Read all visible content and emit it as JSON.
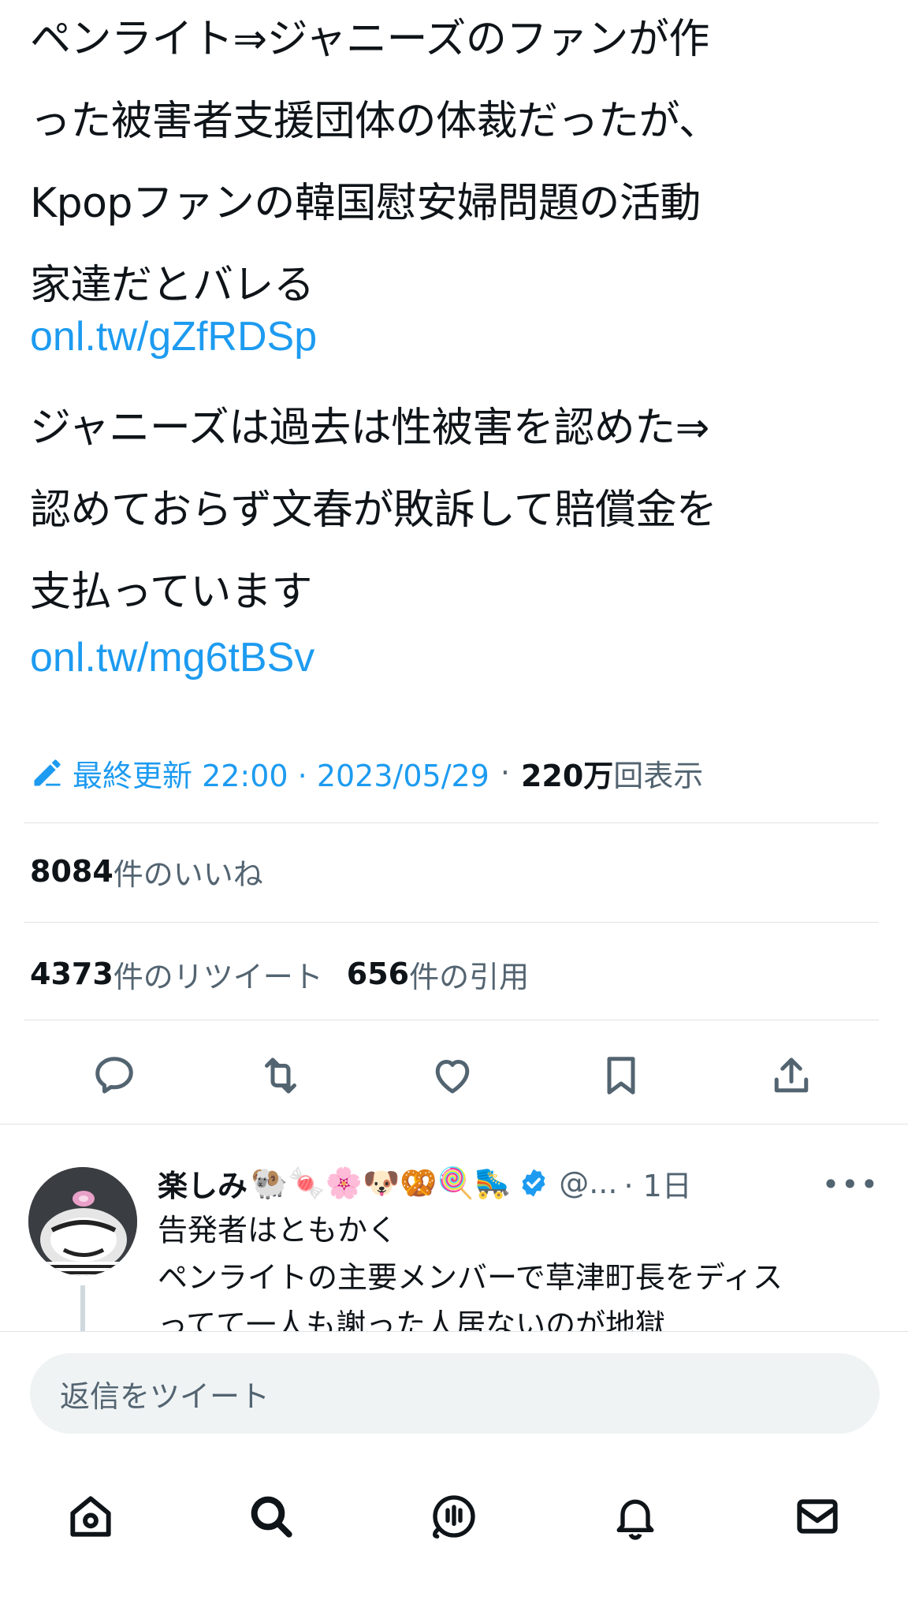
{
  "tweet": {
    "paragraph1": [
      "ペンライト⇒ジャニーズのファンが作",
      "った被害者支援団体の体裁だったが、",
      "Kpopファンの韓国慰安婦問題の活動",
      "家達だとバレる"
    ],
    "link1": "onl.tw/gZfRDSp",
    "paragraph2": [
      "ジャニーズは過去は性被害を認めた⇒",
      "認めておらず文春が敗訴して賠償金を",
      "支払っています"
    ],
    "link2": "onl.tw/mg6tBSv"
  },
  "meta": {
    "edited_icon": "pencil-edit-icon",
    "edited_label": "最終更新 22:00 · 2023/05/29",
    "separator": "·",
    "views_count": "220万",
    "views_label": "回表示"
  },
  "stats": {
    "likes_count": "8084",
    "likes_label": "件のいいね",
    "retweets_count": "4373",
    "retweets_label": "件のリツイート",
    "quotes_count": "656",
    "quotes_label": "件の引用"
  },
  "actions": {
    "icons": [
      "reply-icon",
      "retweet-icon",
      "like-icon",
      "bookmark-icon",
      "share-icon"
    ]
  },
  "reply": {
    "name": "楽しみ",
    "emojis": "🐏🍬🌸🐶🥨🍭🛼",
    "handle": "@...",
    "time": "· 1日",
    "more": "•••",
    "lines": [
      "告発者はともかく",
      "ペンライトの主要メンバーで草津町長をディス",
      "ってて一人も謝った人居ないのが地獄"
    ]
  },
  "reply_box": {
    "placeholder": "返信をツイート"
  },
  "tabbar": {
    "icons": [
      "home-icon",
      "search-icon",
      "spaces-icon",
      "notifications-icon",
      "messages-icon"
    ]
  },
  "colors": {
    "link": "#1d9bf0",
    "text": "#0f1419",
    "secondary": "#536471",
    "divider": "#dfe3e6",
    "input_bg": "#eff3f4"
  }
}
